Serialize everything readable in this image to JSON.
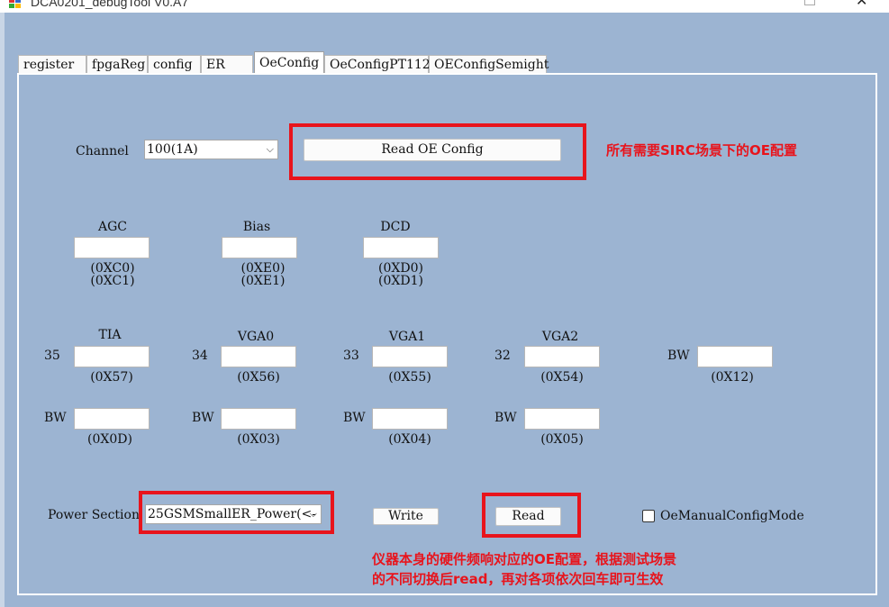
{
  "window": {
    "title": "DCA0201_debugTool V0.A7",
    "close_glyph": "✕"
  },
  "tabs": [
    {
      "label": "register"
    },
    {
      "label": "fpgaReg"
    },
    {
      "label": "config"
    },
    {
      "label": "ER"
    },
    {
      "label": "OeConfig",
      "active": true
    },
    {
      "label": "OeConfigPT112"
    },
    {
      "label": "OEConfigSemight"
    }
  ],
  "channel": {
    "label": "Channel",
    "value": "100(1A)"
  },
  "read_oe_button": "Read OE Config",
  "annotation_top": "所有需要SIRC场景下的OE配置",
  "row1": [
    {
      "title": "AGC",
      "addr1": "(0XC0)",
      "addr2": "(0XC1)"
    },
    {
      "title": "Bias",
      "addr1": "(0XE0)",
      "addr2": "(0XE1)"
    },
    {
      "title": "DCD",
      "addr1": "(0XD0)",
      "addr2": "(0XD1)"
    }
  ],
  "row2": [
    {
      "prefix": "35",
      "title": "TIA",
      "addr": "(0X57)"
    },
    {
      "prefix": "34",
      "title": "VGA0",
      "addr": "(0X56)"
    },
    {
      "prefix": "33",
      "title": "VGA1",
      "addr": "(0X55)"
    },
    {
      "prefix": "32",
      "title": "VGA2",
      "addr": "(0X54)"
    },
    {
      "prefix": "BW",
      "title": "",
      "addr": "(0X12)"
    }
  ],
  "row3": [
    {
      "prefix": "BW",
      "addr": "(0X0D)"
    },
    {
      "prefix": "BW",
      "addr": "(0X03)"
    },
    {
      "prefix": "BW",
      "addr": "(0X04)"
    },
    {
      "prefix": "BW",
      "addr": "(0X05)"
    }
  ],
  "power": {
    "label": "Power Section",
    "value": "25GSMSmallER_Power(<-"
  },
  "write_button": "Write",
  "read_button": "Read",
  "manual_mode": {
    "label": "OeManualConfigMode",
    "checked": false
  },
  "annotation_bottom": [
    "仪器本身的硬件频响对应的OE配置，根据测试场景",
    "的不同切换后read，再对各项依次回车即可生效"
  ],
  "colors": {
    "background": "#9cb4d2",
    "annotation_red": "#e8141c",
    "panel_border": "#ffffff"
  }
}
